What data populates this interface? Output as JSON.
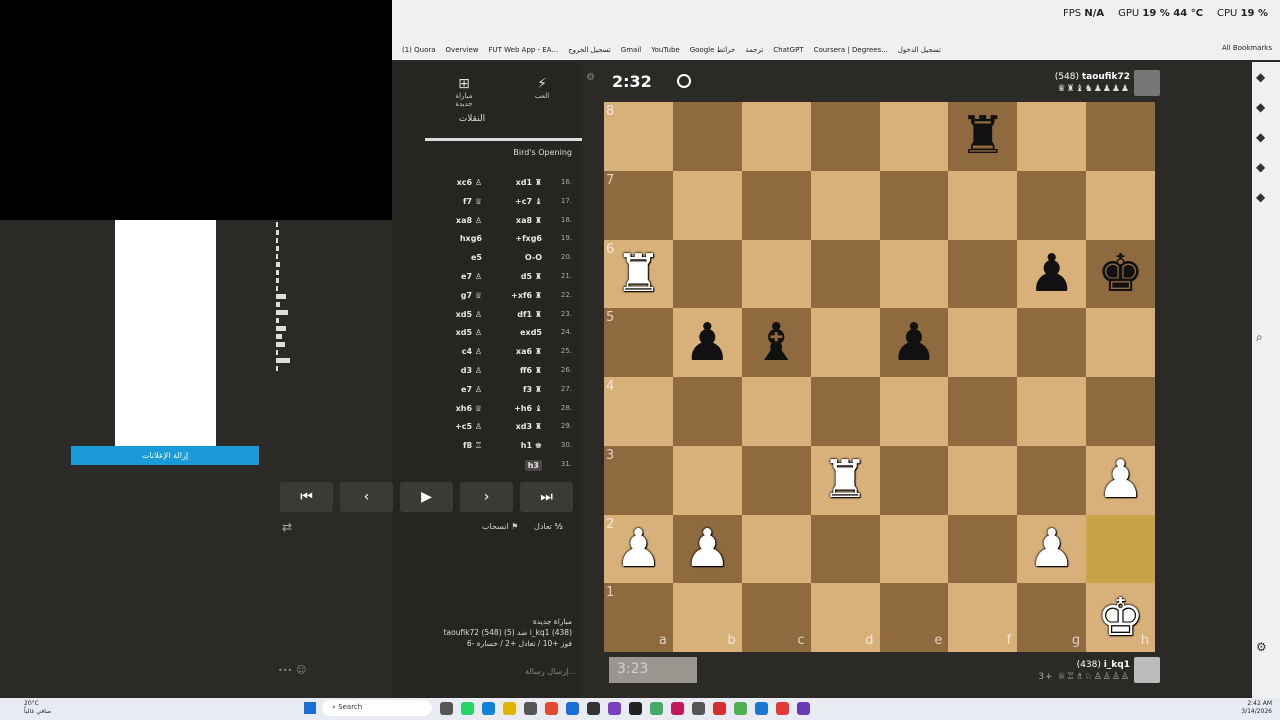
{
  "browser": {
    "stats": {
      "fps_label": "FPS",
      "fps": "N/A",
      "gpu_label": "GPU",
      "gpu": "19 % 44 °C",
      "cpu_label": "CPU",
      "cpu": "19 %"
    },
    "bookmarks": [
      "(1) Quora",
      "Overview",
      "FUT Web App - EA...",
      "تسجيل الخروج",
      "Gmail",
      "YouTube",
      "Google خرائط",
      "ترجمة",
      "ChatGPT",
      "Coursera | Degrees...",
      "تسجيل الدخول"
    ],
    "all_bookmarks": "All Bookmarks"
  },
  "left": {
    "remove_ads": "إزالة الإعلانات"
  },
  "panel": {
    "tab_play": "العب",
    "tab_new_game": "مباراة جديدة",
    "tab_moves": "النقلات",
    "opening": "Bird's Opening"
  },
  "moves": [
    {
      "n": "16.",
      "w": "xd1 ♜",
      "b": "xc6 ♙"
    },
    {
      "n": "17.",
      "w": "+c7 ♝",
      "b": "f7 ♕"
    },
    {
      "n": "18.",
      "w": "xa8 ♜",
      "b": "xa8 ♙"
    },
    {
      "n": "19.",
      "w": "+fxg6",
      "b": "hxg6"
    },
    {
      "n": "20.",
      "w": "O-O",
      "b": "e5"
    },
    {
      "n": "21.",
      "w": "d5 ♜",
      "b": "e7 ♙"
    },
    {
      "n": "22.",
      "w": "+xf6 ♜",
      "b": "g7 ♕"
    },
    {
      "n": "23.",
      "w": "df1 ♜",
      "b": "xd5 ♙"
    },
    {
      "n": "24.",
      "w": "exd5",
      "b": "xd5 ♙"
    },
    {
      "n": "25.",
      "w": "xa6 ♜",
      "b": "c4 ♙"
    },
    {
      "n": "26.",
      "w": "ff6 ♜",
      "b": "d3 ♙"
    },
    {
      "n": "27.",
      "w": "f3 ♜",
      "b": "e7 ♙"
    },
    {
      "n": "28.",
      "w": "+h6 ♝",
      "b": "xh6 ♕"
    },
    {
      "n": "29.",
      "w": "xd3 ♜",
      "b": "+c5 ♙"
    },
    {
      "n": "30.",
      "w": "h1 ♚",
      "b": "f8 ♖"
    },
    {
      "n": "31.",
      "w": "h3",
      "b": ""
    }
  ],
  "nav": {
    "first": "⏮",
    "prev": "‹",
    "play": "▶",
    "next": "›",
    "last": "⏭"
  },
  "actions": {
    "resign": "انسحاب",
    "draw": "تعادل",
    "half": "½"
  },
  "game_info": {
    "line1": "مباراة جديدة",
    "line2": "taoufik72 (548) (5) ضد i_kq1 (438)",
    "line3": "فوز +10 / تعادل +2 / خسارة -6"
  },
  "chat_placeholder": "إرسال رسالة...",
  "clocks": {
    "top": "2:32",
    "bottom": "3:23"
  },
  "players": {
    "top": {
      "name": "taoufik72",
      "rating": "(548)",
      "captured": "♛♜♝♞♟♟♟♟"
    },
    "bottom": {
      "name": "i_kq1",
      "rating": "(438)",
      "captured": "3+ ♕♖♗♘♙♙♙♙"
    }
  },
  "board": {
    "ranks": [
      "8",
      "7",
      "6",
      "5",
      "4",
      "3",
      "2",
      "1"
    ],
    "files": [
      "a",
      "b",
      "c",
      "d",
      "e",
      "f",
      "g",
      "h"
    ],
    "pieces": {
      "f8": "♜",
      "a6": "♖",
      "g6": "♟",
      "h6": "♚",
      "b5": "♟",
      "c5": "♝",
      "e5": "♟",
      "d3": "♖",
      "h3": "♙",
      "a2": "♙",
      "b2": "♙",
      "g2": "♙",
      "h1": "♔"
    },
    "highlight": [
      "h2"
    ]
  },
  "taskbar": {
    "weather_temp": "20°C",
    "weather_desc": "صافي غالباً",
    "search": "Search",
    "time": "2:42 AM",
    "date": "3/14/2026"
  }
}
